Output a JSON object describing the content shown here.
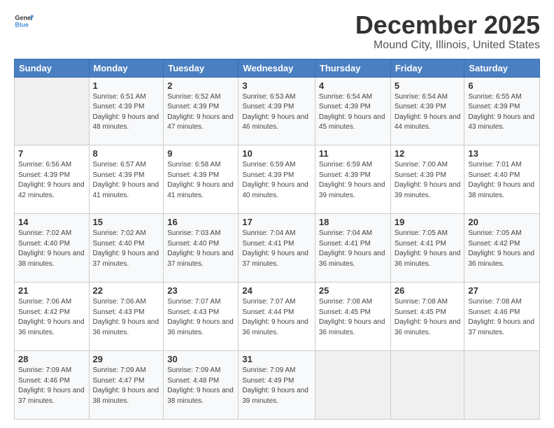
{
  "header": {
    "logo_general": "General",
    "logo_blue": "Blue",
    "month_title": "December 2025",
    "location": "Mound City, Illinois, United States"
  },
  "days_of_week": [
    "Sunday",
    "Monday",
    "Tuesday",
    "Wednesday",
    "Thursday",
    "Friday",
    "Saturday"
  ],
  "weeks": [
    [
      {
        "day": "",
        "sunrise": "",
        "sunset": "",
        "daylight": ""
      },
      {
        "day": "1",
        "sunrise": "Sunrise: 6:51 AM",
        "sunset": "Sunset: 4:39 PM",
        "daylight": "Daylight: 9 hours and 48 minutes."
      },
      {
        "day": "2",
        "sunrise": "Sunrise: 6:52 AM",
        "sunset": "Sunset: 4:39 PM",
        "daylight": "Daylight: 9 hours and 47 minutes."
      },
      {
        "day": "3",
        "sunrise": "Sunrise: 6:53 AM",
        "sunset": "Sunset: 4:39 PM",
        "daylight": "Daylight: 9 hours and 46 minutes."
      },
      {
        "day": "4",
        "sunrise": "Sunrise: 6:54 AM",
        "sunset": "Sunset: 4:39 PM",
        "daylight": "Daylight: 9 hours and 45 minutes."
      },
      {
        "day": "5",
        "sunrise": "Sunrise: 6:54 AM",
        "sunset": "Sunset: 4:39 PM",
        "daylight": "Daylight: 9 hours and 44 minutes."
      },
      {
        "day": "6",
        "sunrise": "Sunrise: 6:55 AM",
        "sunset": "Sunset: 4:39 PM",
        "daylight": "Daylight: 9 hours and 43 minutes."
      }
    ],
    [
      {
        "day": "7",
        "sunrise": "Sunrise: 6:56 AM",
        "sunset": "Sunset: 4:39 PM",
        "daylight": "Daylight: 9 hours and 42 minutes."
      },
      {
        "day": "8",
        "sunrise": "Sunrise: 6:57 AM",
        "sunset": "Sunset: 4:39 PM",
        "daylight": "Daylight: 9 hours and 41 minutes."
      },
      {
        "day": "9",
        "sunrise": "Sunrise: 6:58 AM",
        "sunset": "Sunset: 4:39 PM",
        "daylight": "Daylight: 9 hours and 41 minutes."
      },
      {
        "day": "10",
        "sunrise": "Sunrise: 6:59 AM",
        "sunset": "Sunset: 4:39 PM",
        "daylight": "Daylight: 9 hours and 40 minutes."
      },
      {
        "day": "11",
        "sunrise": "Sunrise: 6:59 AM",
        "sunset": "Sunset: 4:39 PM",
        "daylight": "Daylight: 9 hours and 39 minutes."
      },
      {
        "day": "12",
        "sunrise": "Sunrise: 7:00 AM",
        "sunset": "Sunset: 4:39 PM",
        "daylight": "Daylight: 9 hours and 39 minutes."
      },
      {
        "day": "13",
        "sunrise": "Sunrise: 7:01 AM",
        "sunset": "Sunset: 4:40 PM",
        "daylight": "Daylight: 9 hours and 38 minutes."
      }
    ],
    [
      {
        "day": "14",
        "sunrise": "Sunrise: 7:02 AM",
        "sunset": "Sunset: 4:40 PM",
        "daylight": "Daylight: 9 hours and 38 minutes."
      },
      {
        "day": "15",
        "sunrise": "Sunrise: 7:02 AM",
        "sunset": "Sunset: 4:40 PM",
        "daylight": "Daylight: 9 hours and 37 minutes."
      },
      {
        "day": "16",
        "sunrise": "Sunrise: 7:03 AM",
        "sunset": "Sunset: 4:40 PM",
        "daylight": "Daylight: 9 hours and 37 minutes."
      },
      {
        "day": "17",
        "sunrise": "Sunrise: 7:04 AM",
        "sunset": "Sunset: 4:41 PM",
        "daylight": "Daylight: 9 hours and 37 minutes."
      },
      {
        "day": "18",
        "sunrise": "Sunrise: 7:04 AM",
        "sunset": "Sunset: 4:41 PM",
        "daylight": "Daylight: 9 hours and 36 minutes."
      },
      {
        "day": "19",
        "sunrise": "Sunrise: 7:05 AM",
        "sunset": "Sunset: 4:41 PM",
        "daylight": "Daylight: 9 hours and 36 minutes."
      },
      {
        "day": "20",
        "sunrise": "Sunrise: 7:05 AM",
        "sunset": "Sunset: 4:42 PM",
        "daylight": "Daylight: 9 hours and 36 minutes."
      }
    ],
    [
      {
        "day": "21",
        "sunrise": "Sunrise: 7:06 AM",
        "sunset": "Sunset: 4:42 PM",
        "daylight": "Daylight: 9 hours and 36 minutes."
      },
      {
        "day": "22",
        "sunrise": "Sunrise: 7:06 AM",
        "sunset": "Sunset: 4:43 PM",
        "daylight": "Daylight: 9 hours and 36 minutes."
      },
      {
        "day": "23",
        "sunrise": "Sunrise: 7:07 AM",
        "sunset": "Sunset: 4:43 PM",
        "daylight": "Daylight: 9 hours and 36 minutes."
      },
      {
        "day": "24",
        "sunrise": "Sunrise: 7:07 AM",
        "sunset": "Sunset: 4:44 PM",
        "daylight": "Daylight: 9 hours and 36 minutes."
      },
      {
        "day": "25",
        "sunrise": "Sunrise: 7:08 AM",
        "sunset": "Sunset: 4:45 PM",
        "daylight": "Daylight: 9 hours and 36 minutes."
      },
      {
        "day": "26",
        "sunrise": "Sunrise: 7:08 AM",
        "sunset": "Sunset: 4:45 PM",
        "daylight": "Daylight: 9 hours and 36 minutes."
      },
      {
        "day": "27",
        "sunrise": "Sunrise: 7:08 AM",
        "sunset": "Sunset: 4:46 PM",
        "daylight": "Daylight: 9 hours and 37 minutes."
      }
    ],
    [
      {
        "day": "28",
        "sunrise": "Sunrise: 7:09 AM",
        "sunset": "Sunset: 4:46 PM",
        "daylight": "Daylight: 9 hours and 37 minutes."
      },
      {
        "day": "29",
        "sunrise": "Sunrise: 7:09 AM",
        "sunset": "Sunset: 4:47 PM",
        "daylight": "Daylight: 9 hours and 38 minutes."
      },
      {
        "day": "30",
        "sunrise": "Sunrise: 7:09 AM",
        "sunset": "Sunset: 4:48 PM",
        "daylight": "Daylight: 9 hours and 38 minutes."
      },
      {
        "day": "31",
        "sunrise": "Sunrise: 7:09 AM",
        "sunset": "Sunset: 4:49 PM",
        "daylight": "Daylight: 9 hours and 39 minutes."
      },
      {
        "day": "",
        "sunrise": "",
        "sunset": "",
        "daylight": ""
      },
      {
        "day": "",
        "sunrise": "",
        "sunset": "",
        "daylight": ""
      },
      {
        "day": "",
        "sunrise": "",
        "sunset": "",
        "daylight": ""
      }
    ]
  ]
}
